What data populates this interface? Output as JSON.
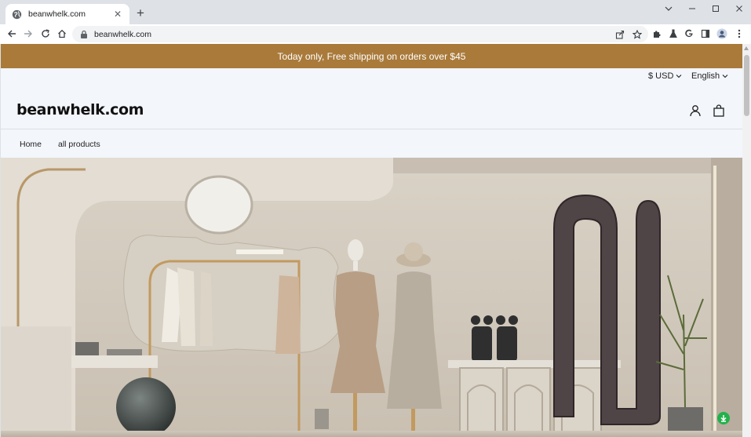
{
  "browser": {
    "tab_title": "beanwhelk.com",
    "url": "beanwhelk.com",
    "new_tab": "+",
    "tab_close": "✕"
  },
  "site": {
    "announcement": "Today only, Free shipping on orders over $45",
    "currency": "$ USD",
    "language": "English",
    "logo": "beanwhelk.com",
    "nav": [
      "Home",
      "all products"
    ]
  },
  "colors": {
    "announcement_bg": "#a97a3a",
    "page_bg": "#f3f6fb",
    "fab": "#22b14c"
  },
  "icons": {
    "account": "account-icon",
    "cart": "cart-icon",
    "floating": "download-icon"
  }
}
